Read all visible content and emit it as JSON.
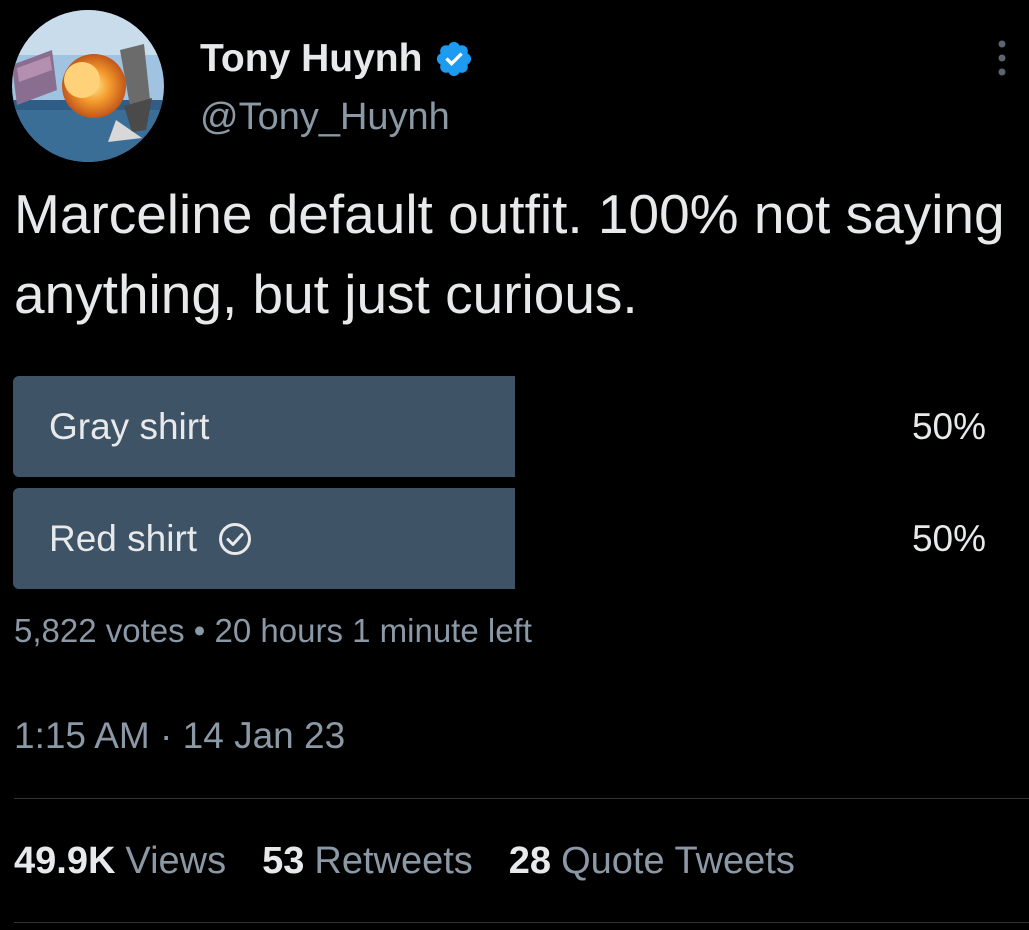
{
  "author": {
    "display_name": "Tony Huynh",
    "handle": "@Tony_Huynh",
    "verified_icon": "verified-badge-icon",
    "verified_color": "#1d9bf0"
  },
  "tweet": {
    "text": "Marceline default outfit. 100% not saying anything, but just curious."
  },
  "poll": {
    "options": [
      {
        "label": "Gray shirt",
        "percent_text": "50%",
        "percent": 50,
        "selected": false
      },
      {
        "label": "Red shirt",
        "percent_text": "50%",
        "percent": 50,
        "selected": true
      }
    ],
    "votes": "5,822 votes",
    "separator": "•",
    "time_left": "20 hours 1 minute left",
    "bar_color": "#3f5366"
  },
  "timestamp": {
    "time": "1:15 AM",
    "separator": "·",
    "date": "14 Jan 23"
  },
  "stats": {
    "views_count": "49.9K",
    "views_label": "Views",
    "retweets_count": "53",
    "retweets_label": "Retweets",
    "quotes_count": "28",
    "quotes_label": "Quote Tweets"
  },
  "icons": {
    "more": "more-vertical-icon",
    "check": "check-circle-icon"
  }
}
